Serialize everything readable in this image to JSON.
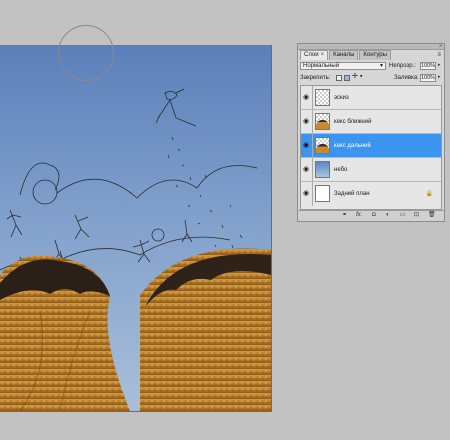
{
  "layers_panel": {
    "tabs": [
      {
        "label": "Слои",
        "close": "×"
      },
      {
        "label": "Каналы"
      },
      {
        "label": "Контуры"
      }
    ],
    "menu_icon": "≡",
    "blend_mode": "Нормальный",
    "opacity_label": "Непрозр.:",
    "opacity_value": "100%",
    "lock_label": "Закрепить:",
    "fill_label": "Заливка:",
    "fill_value": "100%",
    "layers": [
      {
        "name": "эскиз",
        "thumb": "checker",
        "selected": false
      },
      {
        "name": "кекс ближний",
        "thumb": "cake",
        "selected": false
      },
      {
        "name": "кекс дальний",
        "thumb": "cake",
        "selected": true
      },
      {
        "name": "небо",
        "thumb": "sky",
        "selected": false
      },
      {
        "name": "Задний план",
        "thumb": "white",
        "selected": false,
        "locked": true
      }
    ],
    "bottom_icons": [
      "link-icon",
      "fx-icon",
      "mask-icon",
      "adjustment-icon",
      "group-icon",
      "new-layer-icon",
      "trash-icon"
    ],
    "colors": {
      "selected": "#3b95f0"
    }
  }
}
